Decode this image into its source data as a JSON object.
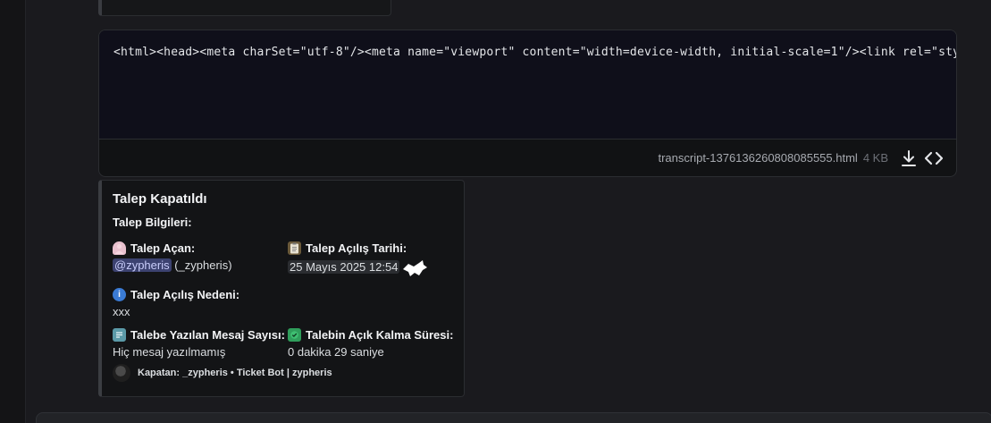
{
  "file_preview": {
    "code": "<html><head><meta charSet=\"utf-8\"/><meta name=\"viewport\" content=\"width=device-width, initial-scale=1\"/><link rel=\"stylesheet\" href=\"",
    "file_name": "transcript-1376136260808085555.html",
    "file_size": "4 KB",
    "download_icon": "download-icon",
    "code_icon": "code-icon"
  },
  "embed": {
    "title": "Talep Kapatıldı",
    "description": "Talep Bilgileri:",
    "fields": {
      "opener": {
        "name": "Talep Açan:",
        "mention": "@zypheris",
        "value_suffix": " (_zypheris)",
        "icon": "person-icon"
      },
      "open_date": {
        "name": "Talep Açılış Tarihi:",
        "value": "25 Mayıs 2025 12:54",
        "icon": "clipboard-icon"
      },
      "reason": {
        "name": "Talep Açılış Nedeni:",
        "value": "xxx",
        "icon": "info-icon"
      },
      "message_count": {
        "name": "Talebe Yazılan Mesaj Sayısı:",
        "value": "Hiç mesaj yazılmamış",
        "icon": "speech-balloon-icon"
      },
      "duration": {
        "name": "Talebin Açık Kalma Süresi:",
        "value": "0 dakika 29 saniye",
        "icon": "check-shield-icon"
      }
    },
    "footer": {
      "text": "Kapatan: _zypheris • Ticket Bot | zypheris"
    }
  },
  "colors": {
    "mention_bg": "#3c4270",
    "embed_bg": "#131416",
    "code_bg": "#0f0f1a"
  }
}
